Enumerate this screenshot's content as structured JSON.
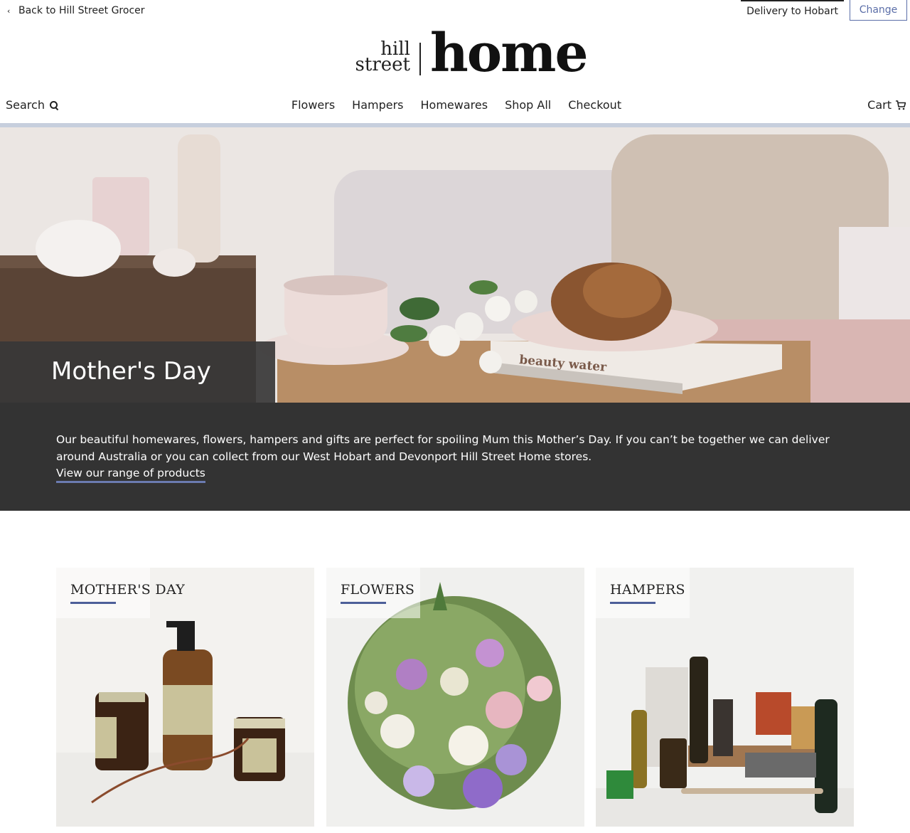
{
  "topbar": {
    "back_label": "Back to Hill Street Grocer",
    "delivery_label": "Delivery to Hobart",
    "change_label": "Change"
  },
  "logo": {
    "line1": "hill",
    "line2": "street",
    "brand": "home"
  },
  "nav": {
    "search_label": "Search",
    "items": [
      {
        "label": "Flowers"
      },
      {
        "label": "Hampers"
      },
      {
        "label": "Homewares"
      },
      {
        "label": "Shop All"
      },
      {
        "label": "Checkout"
      }
    ],
    "cart_label": "Cart"
  },
  "hero": {
    "title": "Mother's Day",
    "book_text": "beauty water"
  },
  "intro": {
    "text": "Our beautiful homewares, flowers, hampers and gifts are perfect for spoiling Mum this Mother’s Day. If you can’t be together we can deliver around Australia or you can collect from our West Hobart and Devonport Hill Street Home stores.",
    "link_label": "View our range of products"
  },
  "tiles": [
    {
      "label": "MOTHER'S DAY"
    },
    {
      "label": "FLOWERS"
    },
    {
      "label": "HAMPERS"
    }
  ],
  "colors": {
    "accent": "#5b6ea8",
    "underline": "#4d5f99",
    "dark_band": "#333333",
    "nav_rule": "#c7cfdd"
  }
}
